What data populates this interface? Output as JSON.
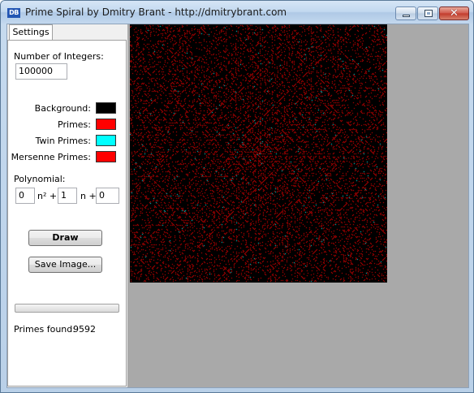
{
  "window": {
    "title": "Prime Spiral by Dmitry Brant - http://dmitrybrant.com",
    "icon": "DB"
  },
  "tabs": [
    {
      "label": "Settings",
      "active": true
    }
  ],
  "settings": {
    "num_integers_label": "Number of Integers:",
    "num_integers_value": "100000",
    "colors": [
      {
        "label": "Background:",
        "color": "#000000"
      },
      {
        "label": "Primes:",
        "color": "#ff0000"
      },
      {
        "label": "Twin Primes:",
        "color": "#00ffff"
      },
      {
        "label": "Mersenne Primes:",
        "color": "#ff0000"
      }
    ],
    "polynomial_label": "Polynomial:",
    "poly_a": "0",
    "poly_n2": "n² +",
    "poly_b": "1",
    "poly_n": "n +",
    "poly_c": "0",
    "draw_label": "Draw",
    "save_label": "Save Image...",
    "progress": 0,
    "primes_found_label": "Primes found:",
    "primes_found_value": "9592"
  },
  "spiral": {
    "background": "#000000",
    "prime_color": "#ff0000",
    "twin_color": "#00ffff"
  }
}
